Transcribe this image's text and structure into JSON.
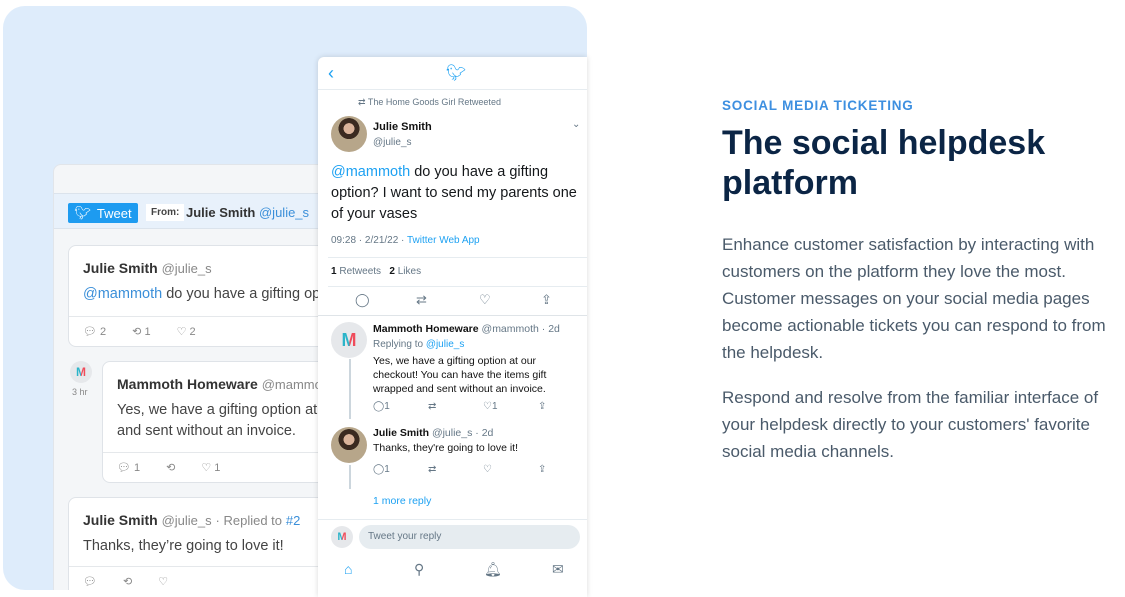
{
  "helpdesk": {
    "compose": {
      "tweet_button": "Tweet",
      "from_label": "From:",
      "from_name": "Julie Smith",
      "from_handle": "@julie_s"
    },
    "messages": [
      {
        "name": "Julie Smith",
        "handle": "@julie_s",
        "mention": "@mammoth",
        "text": " do you have a gifting op",
        "replies": "2",
        "retweets": "1",
        "likes": "2"
      },
      {
        "name": "Mammoth Homeware",
        "handle": "@mammo",
        "text_line1": "Yes, we have a gifting option at",
        "text_line2": "and sent without an invoice.",
        "replies": "1",
        "likes": "1",
        "time": "3 hr"
      },
      {
        "name": "Julie Smith",
        "handle": "@julie_s",
        "replied_to_label": "· Replied to",
        "replied_to": "#2",
        "text": "Thanks, they’re going to love it!"
      }
    ]
  },
  "twitter": {
    "retweeted_by": "The Home Goods Girl Retweeted",
    "main": {
      "name": "Julie Smith",
      "handle": "@julie_s",
      "mention": "@mammoth",
      "text": " do you have a gifting option? I want to send my parents one of your vases",
      "meta": "09:28 · 2/21/22 · ",
      "source": "Twitter Web App",
      "retweets_count": "1",
      "retweets_label": "Retweets",
      "likes_count": "2",
      "likes_label": "Likes"
    },
    "replies": [
      {
        "name": "Mammoth Homeware",
        "handle": "@mammoth · 2d",
        "replying_label": "Replying to",
        "replying_to": "@julie_s",
        "text": "Yes, we have a gifting option at our checkout! You can have the items gift wrapped and sent without an invoice.",
        "replies": "1",
        "likes": "1"
      },
      {
        "name": "Julie Smith",
        "handle": "@julie_s · 2d",
        "text": "Thanks, they're going to love it!",
        "replies": "1"
      }
    ],
    "more_replies": "1 more reply",
    "reply_placeholder": "Tweet your reply"
  },
  "content": {
    "eyebrow": "SOCIAL MEDIA TICKETING",
    "title": "The social helpdesk platform",
    "paragraph1": "Enhance customer satisfaction by interacting with customers on the platform they love the most. Customer messages on your social media pages become actionable tickets you can respond to from the helpdesk.",
    "paragraph2": "Respond and resolve from the familiar interface of your helpdesk directly to your customers' favorite social media channels."
  },
  "colors": {
    "accent": "#3d8fe0",
    "title": "#0b2545",
    "twitter_blue": "#1da1f2",
    "panel_bg": "#deecfb"
  }
}
